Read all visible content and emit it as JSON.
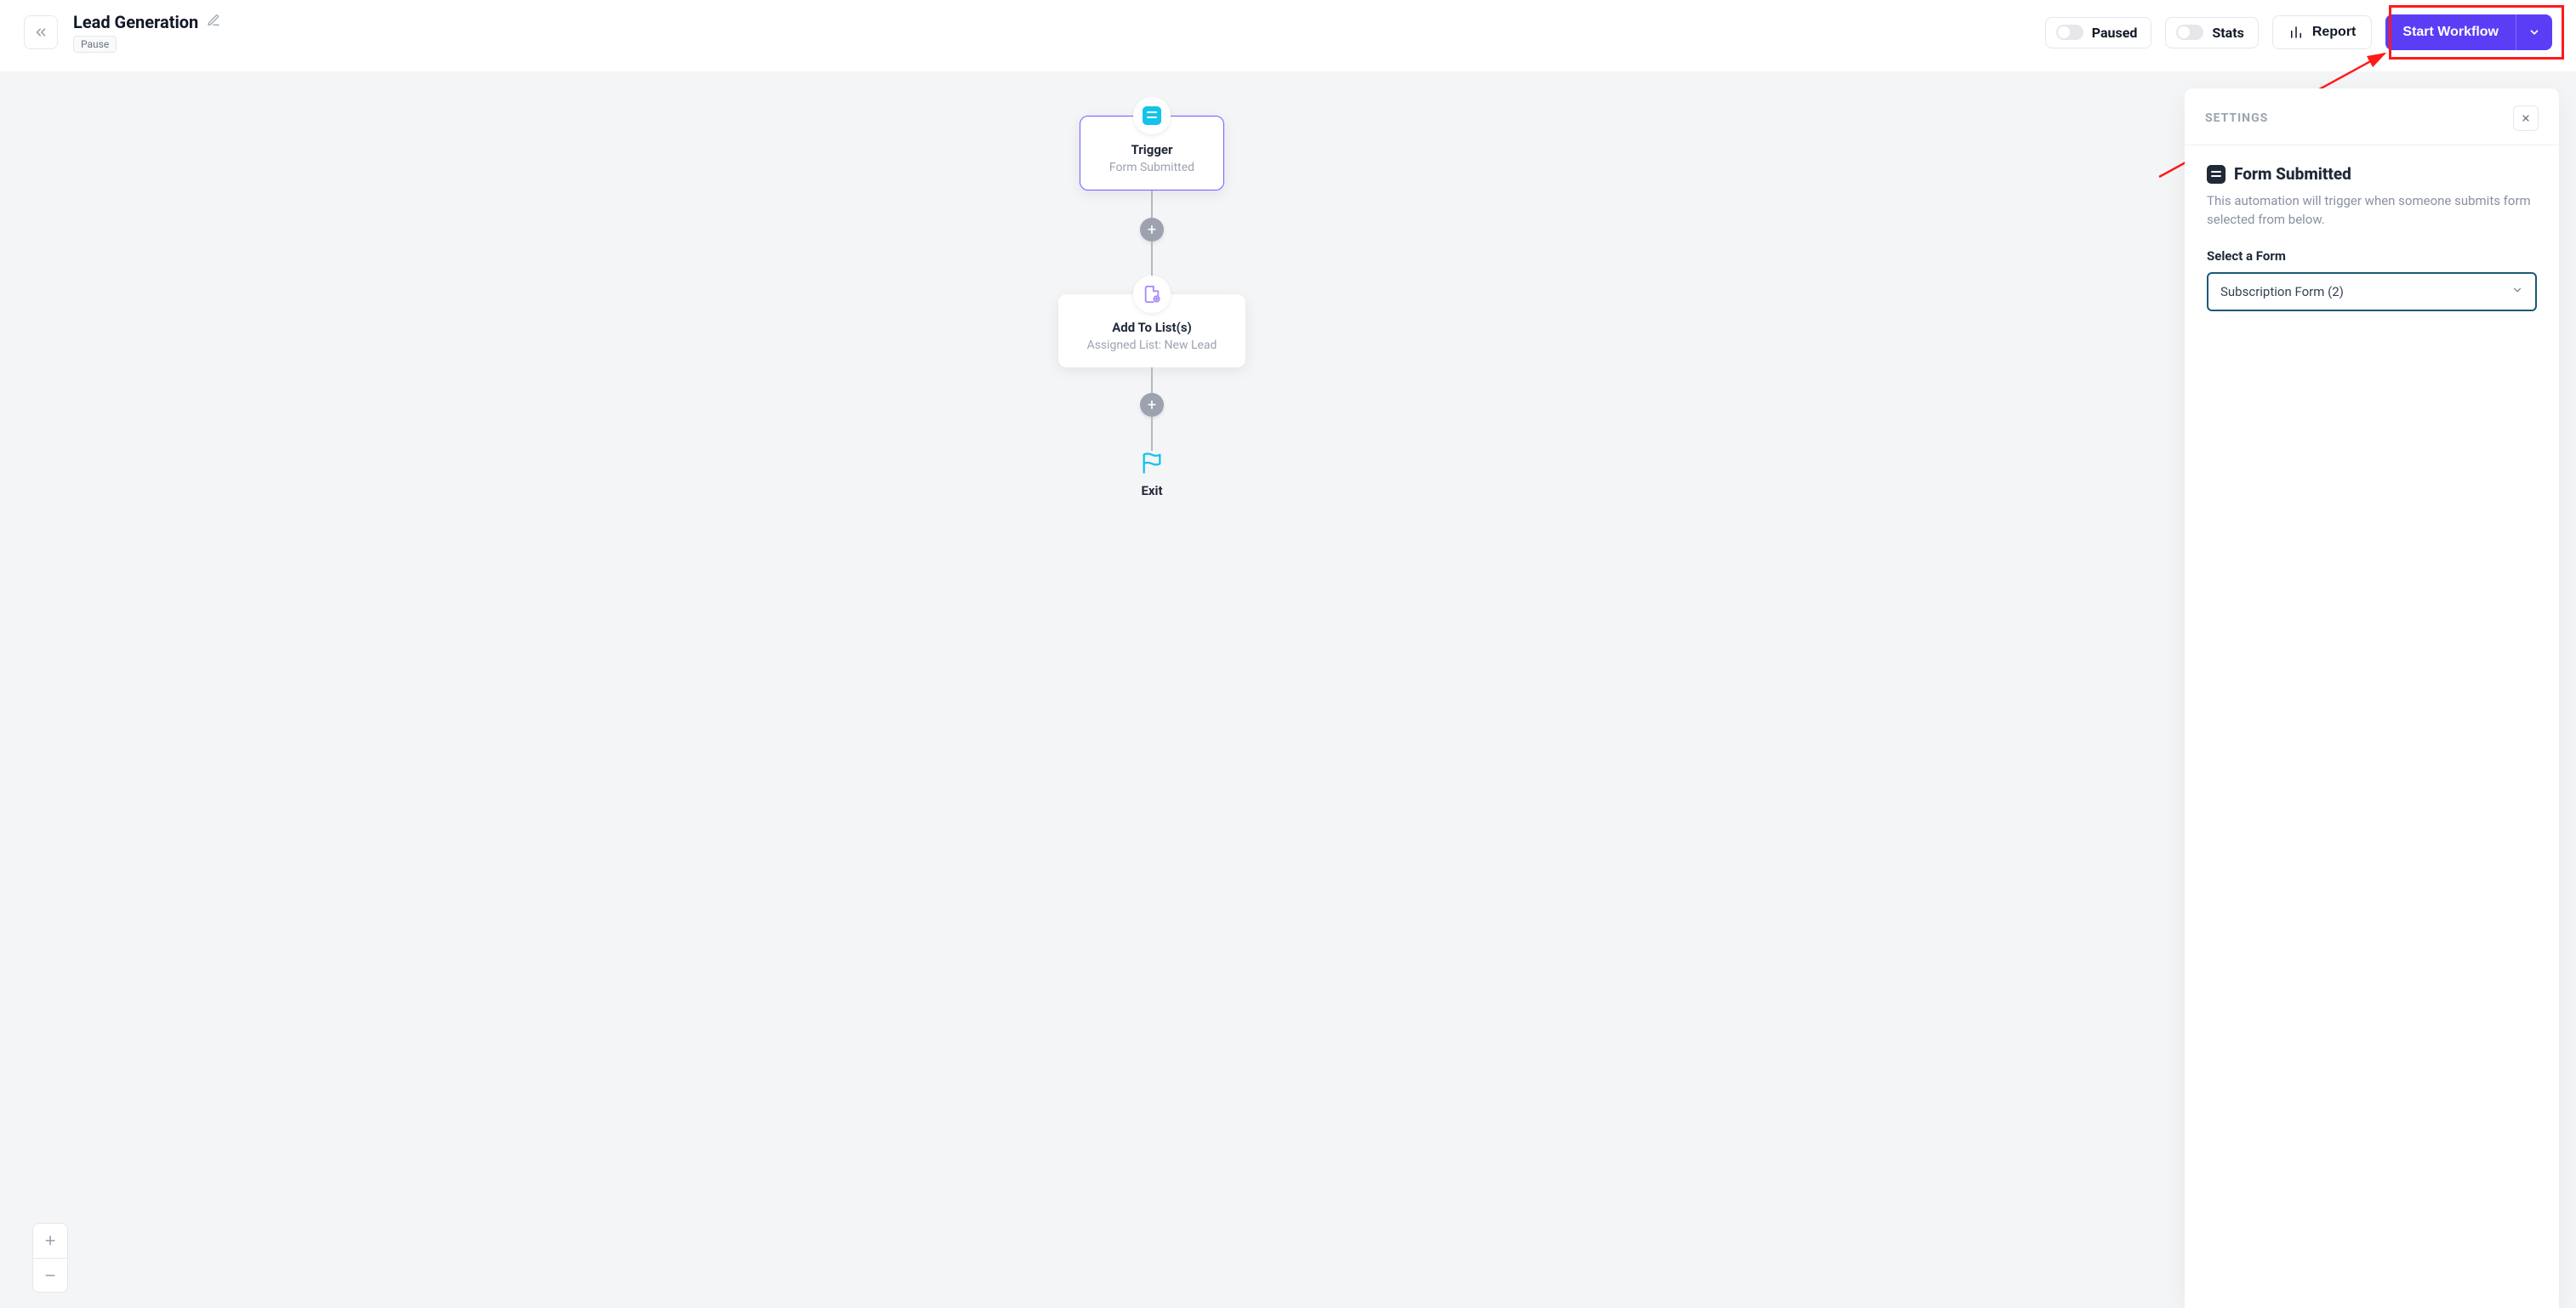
{
  "header": {
    "title": "Lead Generation",
    "status_chip": "Pause",
    "paused_label": "Paused",
    "stats_label": "Stats",
    "report_label": "Report",
    "start_label": "Start Workflow"
  },
  "flow": {
    "trigger": {
      "title": "Trigger",
      "subtitle": "Form Submitted"
    },
    "action": {
      "title": "Add To List(s)",
      "subtitle": "Assigned List: New Lead"
    },
    "exit_label": "Exit"
  },
  "panel": {
    "header": "SETTINGS",
    "title": "Form Submitted",
    "description": "This automation will trigger when someone submits form selected from below.",
    "field_label": "Select a Form",
    "select_value": "Subscription Form (2)"
  }
}
